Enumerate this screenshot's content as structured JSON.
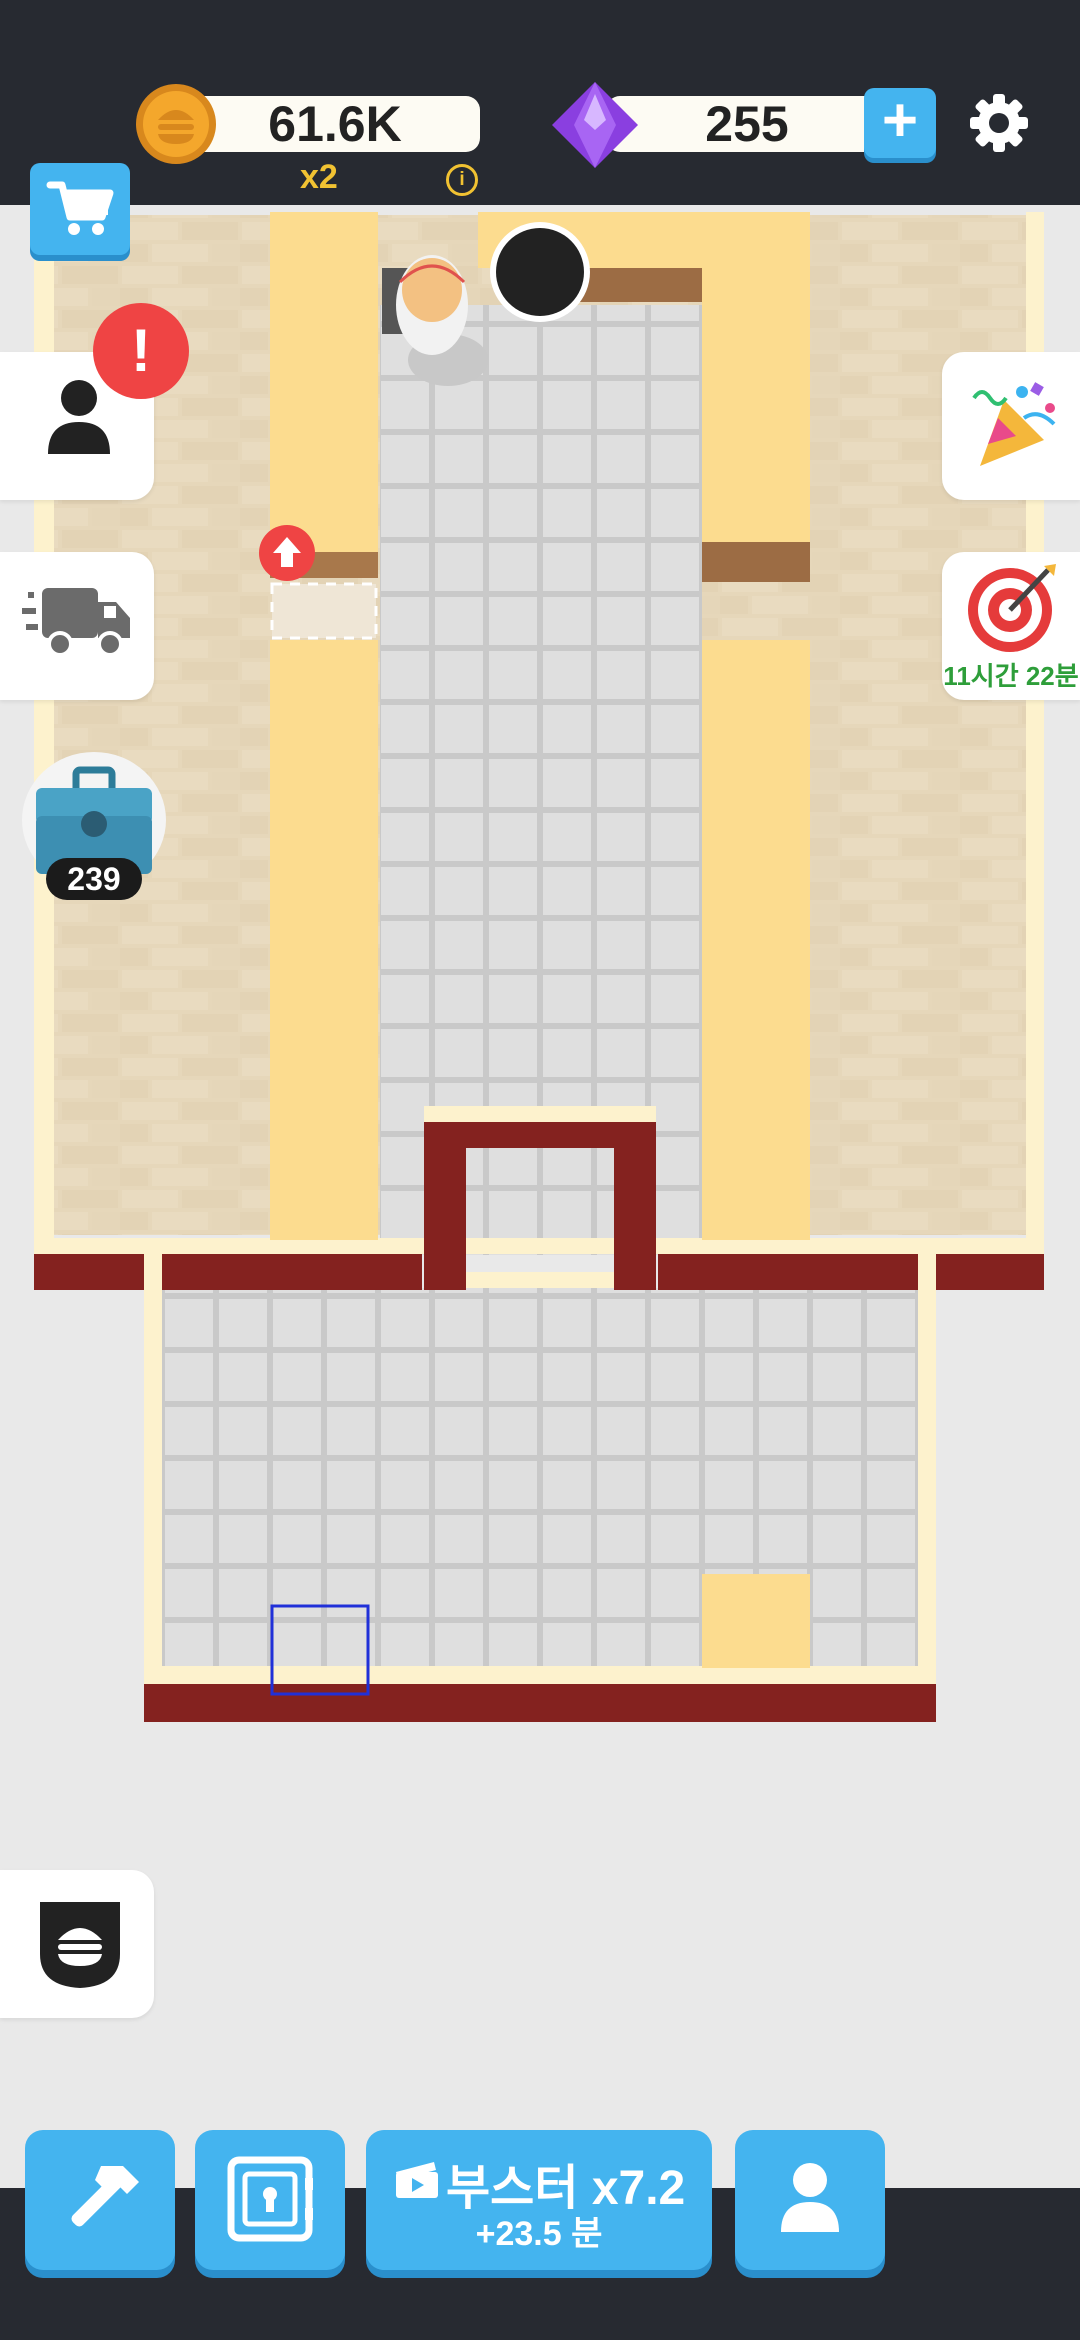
{
  "hud": {
    "coins": "61.6K",
    "multiplier": "x2",
    "info_glyph": "i",
    "gems": "255",
    "add_glyph": "+",
    "coin_icon": "burger-coin-icon",
    "gem_icon": "purple-gem-icon",
    "settings_icon": "gear-icon"
  },
  "left_panel": {
    "cart_icon": "shopping-cart-icon",
    "staff_alert": "!",
    "staff_icon": "person-icon",
    "delivery_icon": "delivery-truck-icon",
    "toolbox_count": "239",
    "brand_icon": "burger-badge-icon"
  },
  "right_panel": {
    "party_icon": "party-popper-icon",
    "target_icon": "target-dart-icon",
    "mission_timer": "11시간 22분"
  },
  "bottom_bar": {
    "build_icon": "hammer-icon",
    "vault_icon": "safe-icon",
    "booster_label": "부스터 x7.2",
    "booster_time": "+23.5 분",
    "booster_icon": "video-ad-icon",
    "profile_icon": "person-icon"
  },
  "colors": {
    "accent_blue": "#44b4ef",
    "wall_yellow": "#fcdc8f",
    "wall_red": "#84221f",
    "alert_red": "#ef4444",
    "timer_green": "#2e9e3a"
  }
}
